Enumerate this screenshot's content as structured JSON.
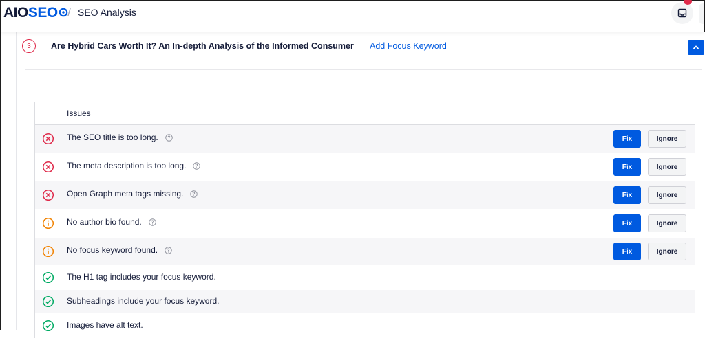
{
  "header": {
    "logo": {
      "aio": "AIO",
      "seo": "SEO"
    },
    "separator": "/",
    "title": "SEO Analysis",
    "notification_icon": "inbox-icon"
  },
  "post": {
    "number": "3",
    "title": "Are Hybrid Cars Worth It? An In-depth Analysis of the Informed Consumer",
    "add_focus_keyword": "Add Focus Keyword",
    "collapse_icon": "chevron-up-icon"
  },
  "table": {
    "header": "Issues",
    "fix_label": "Fix",
    "ignore_label": "Ignore",
    "rows": [
      {
        "status": "error",
        "text": "The SEO title is too long."
      },
      {
        "status": "error",
        "text": "The meta description is too long."
      },
      {
        "status": "error",
        "text": "Open Graph meta tags missing."
      },
      {
        "status": "warning",
        "text": "No author bio found."
      },
      {
        "status": "warning",
        "text": "No focus keyword found."
      },
      {
        "status": "success",
        "text": "The H1 tag includes your focus keyword."
      },
      {
        "status": "success",
        "text": "Subheadings include your focus keyword."
      },
      {
        "status": "success",
        "text": "Images have alt text."
      }
    ]
  },
  "colors": {
    "accent": "#005ae0",
    "error": "#df2a4a",
    "warning": "#f18200",
    "success": "#00aa63",
    "text": "#141b38"
  }
}
